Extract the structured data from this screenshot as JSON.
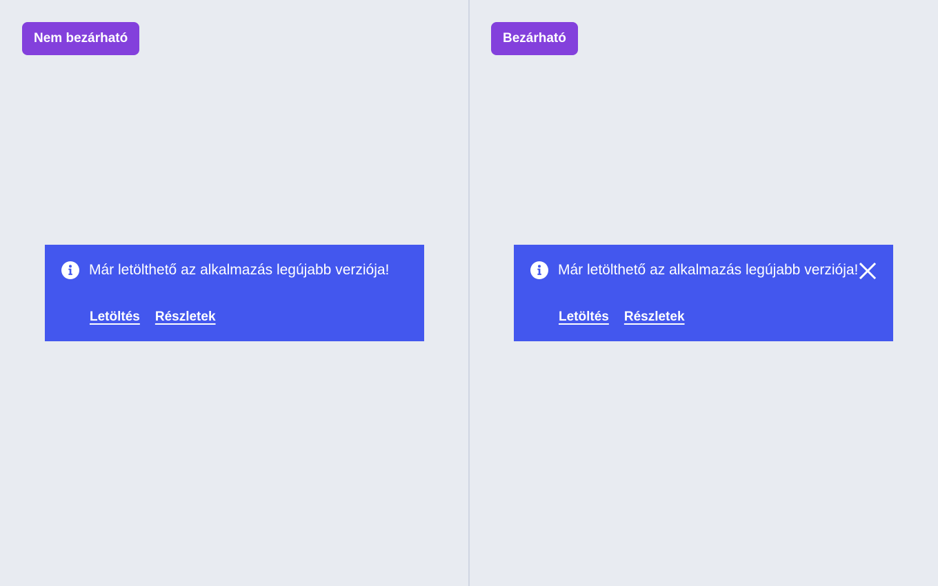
{
  "left_panel": {
    "tag_label": "Nem bezárható",
    "banner": {
      "message": "Már letölthető az alkalmazás legújabb verziója!",
      "links": [
        "Letöltés",
        "Részletek"
      ],
      "info_icon": "info-icon"
    }
  },
  "right_panel": {
    "tag_label": "Bezárható",
    "banner": {
      "message": "Már letölthető az alkalmazás legújabb verziója!",
      "links": [
        "Letöltés",
        "Részletek"
      ],
      "info_icon": "info-icon",
      "close_icon": "close-icon"
    }
  },
  "colors": {
    "background": "#e8ebf1",
    "tag": "#8340dc",
    "banner": "#4357ee",
    "text": "#ffffff",
    "divider": "#cfd5e2"
  }
}
